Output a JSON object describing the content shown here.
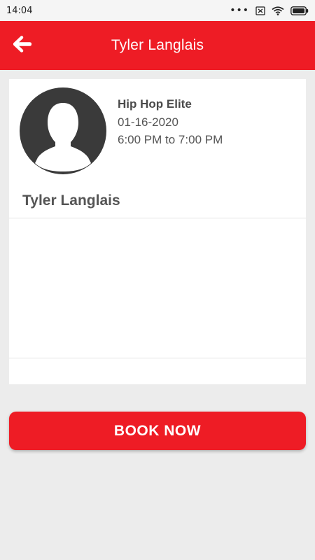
{
  "status_bar": {
    "time": "14:04",
    "icons": [
      "more-dots-icon",
      "sim-off-icon",
      "wifi-icon",
      "battery-icon"
    ]
  },
  "app_bar": {
    "title": "Tyler Langlais",
    "back_icon": "arrow-left-icon",
    "color": "#ee1c25"
  },
  "card": {
    "avatar_icon": "person-silhouette-icon",
    "class_name": "Hip Hop Elite",
    "date": "01-16-2020",
    "time_range": "6:00 PM to 7:00 PM",
    "instructor": "Tyler Langlais",
    "description": ""
  },
  "book_button": {
    "label": "BOOK NOW",
    "color": "#ee1c25"
  }
}
